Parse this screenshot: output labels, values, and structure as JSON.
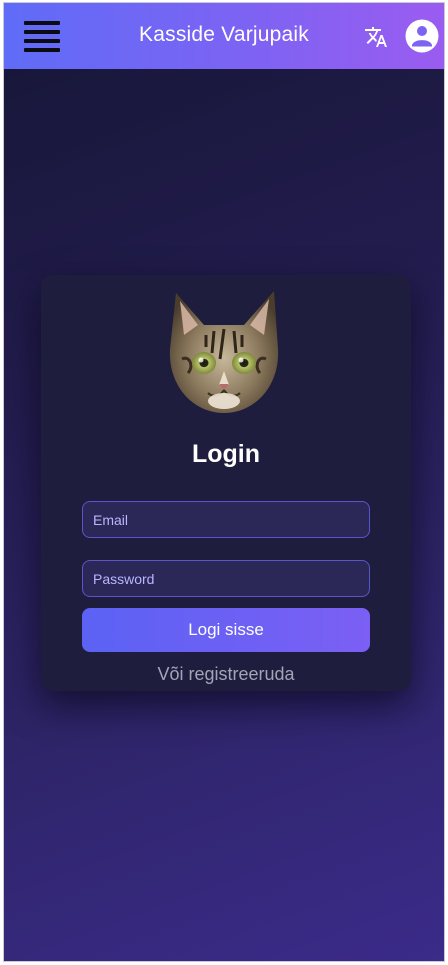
{
  "header": {
    "title": "Kasside Varjupaik",
    "menu_icon": "hamburger-menu-icon",
    "translate_icon": "translate-icon",
    "account_icon": "account-circle-icon"
  },
  "login": {
    "title": "Login",
    "logo_icon": "cat-face-logo",
    "email_placeholder": "Email",
    "password_placeholder": "Password",
    "submit_label": "Logi sisse",
    "register_link": "Või registreeruda"
  },
  "colors": {
    "header_gradient_start": "#5f6cf7",
    "header_gradient_end": "#9a5cf0",
    "card_background": "#1e1d3d",
    "button_gradient_start": "#5b62f4",
    "button_gradient_end": "#7c5ff4"
  }
}
